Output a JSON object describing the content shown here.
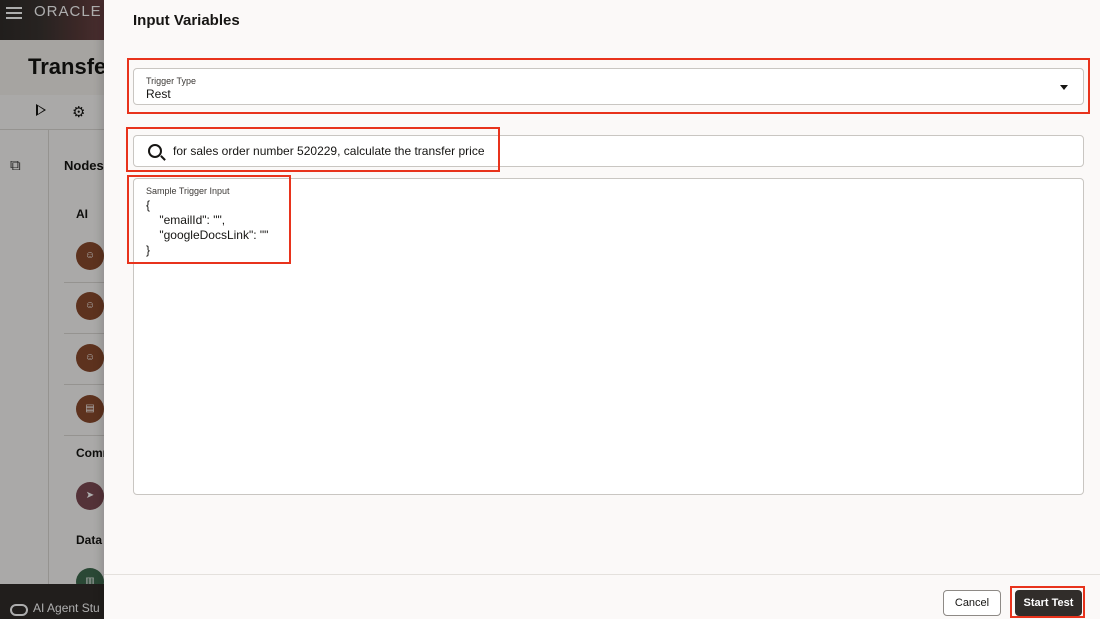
{
  "background_app": {
    "brand": "ORACLE",
    "page_title": "Transfe",
    "nodes_heading": "Nodes",
    "sections": [
      "AI",
      "Comm",
      "Data"
    ],
    "footer_label": "AI Agent Stu"
  },
  "drawer": {
    "title": "Input Variables",
    "trigger_type": {
      "label": "Trigger Type",
      "value": "Rest"
    },
    "search": {
      "value": "for sales order number 520229, calculate the transfer price"
    },
    "sample_trigger_input": {
      "label": "Sample Trigger Input",
      "value": "{\n    \"emailId\": \"\",\n    \"googleDocsLink\": \"\"\n}"
    },
    "buttons": {
      "cancel": "Cancel",
      "start_test": "Start Test"
    }
  },
  "colors": {
    "callout": "#e8331c",
    "primary_button": "#312d2a"
  }
}
